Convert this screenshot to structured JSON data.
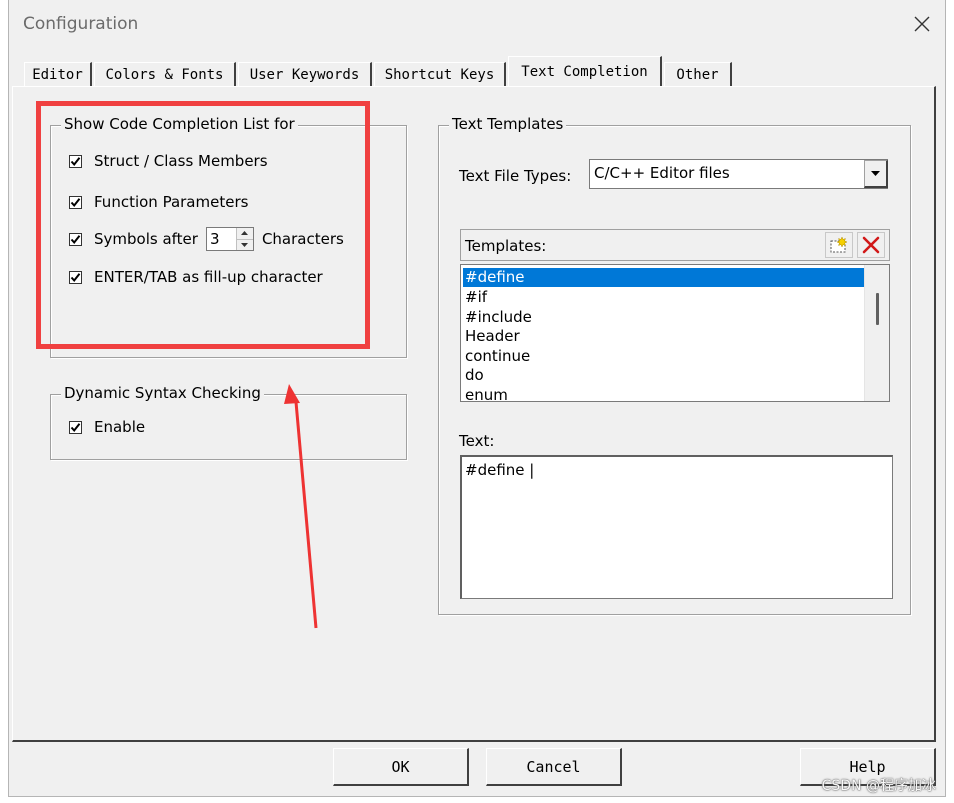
{
  "window": {
    "title": "Configuration"
  },
  "tabs": [
    "Editor",
    "Colors & Fonts",
    "User Keywords",
    "Shortcut Keys",
    "Text Completion",
    "Other"
  ],
  "completion_group": {
    "title": "Show Code Completion List for",
    "struct_members": "Struct / Class Members",
    "function_params": "Function Parameters",
    "symbols_after": "Symbols after",
    "symbols_count": "3",
    "characters": "Characters",
    "enter_tab": "ENTER/TAB as fill-up character"
  },
  "syntax_group": {
    "title": "Dynamic Syntax Checking",
    "enable": "Enable"
  },
  "templates_group": {
    "title": "Text Templates",
    "file_types_label": "Text File Types:",
    "file_types_value": "C/C++ Editor files",
    "templates_label": "Templates:",
    "items": [
      "#define",
      "#if",
      "#include",
      "Header",
      "continue",
      "do",
      "enum"
    ],
    "text_label": "Text:",
    "text_value": "#define |"
  },
  "buttons": {
    "ok": "OK",
    "cancel": "Cancel",
    "help": "Help"
  },
  "watermark": "CSDN @程序加冰",
  "colors": {
    "highlight": "#f04040",
    "selection": "#0078d7",
    "face": "#f0f0f0"
  }
}
